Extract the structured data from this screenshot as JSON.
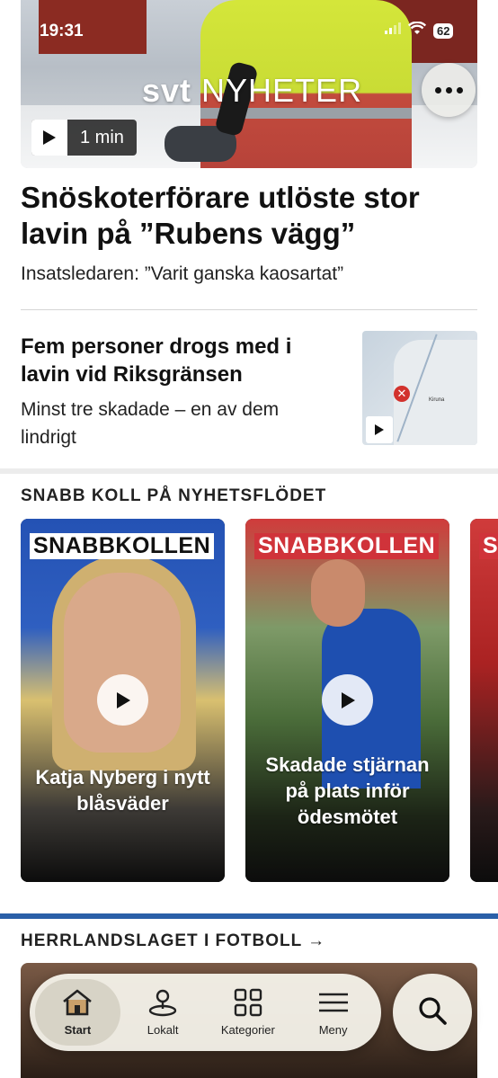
{
  "status_bar": {
    "time": "19:31",
    "battery": "62"
  },
  "hero": {
    "logo_bold": "svt",
    "logo_light": "NYHETER",
    "duration": "1 min",
    "headline": "Snöskoterförare utlöste stor lavin på ”Rubens vägg”",
    "subtitle": "Insatsledaren: ”Varit ganska kaosartat”"
  },
  "article2": {
    "headline": "Fem personer drogs med i lavin vid Riksgränsen",
    "subtitle": "Minst tre skadade – en av dem lindrigt",
    "map_label": "Kiruna"
  },
  "snabb_section": {
    "title": "SNABB KOLL PÅ NYHETSFLÖDET",
    "cards": [
      {
        "badge": "SNABBKOLLEN",
        "caption": "Katja Nyberg i nytt blåsväder"
      },
      {
        "badge": "SNABBKOLLEN",
        "caption": "Skadade stjärnan på plats inför ödesmötet"
      },
      {
        "badge": "S",
        "caption": ""
      }
    ]
  },
  "football_section": {
    "title": "HERRLANDSLAGET I FOTBOLL →"
  },
  "tabbar": {
    "tabs": [
      {
        "label": "Start",
        "icon": "home-icon",
        "active": true
      },
      {
        "label": "Lokalt",
        "icon": "location-pin-icon",
        "active": false
      },
      {
        "label": "Kategorier",
        "icon": "grid-icon",
        "active": false
      },
      {
        "label": "Meny",
        "icon": "menu-icon",
        "active": false
      }
    ],
    "search_icon": "search-icon"
  },
  "colors": {
    "svt_red": "#d0333a",
    "accent_blue": "#2a5fa8"
  }
}
